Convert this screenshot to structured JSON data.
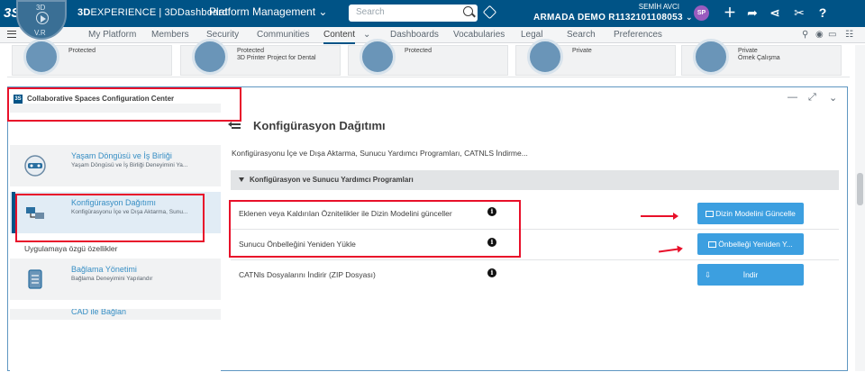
{
  "topbar": {
    "brand_logo": "3S",
    "compass_label": "V.R",
    "compass_quadrant_top": "3D",
    "app_name_bold": "3D",
    "app_name_rest": "EXPERIENCE",
    "app_separator": "|",
    "app_subtitle": "3DDashboard",
    "platform_label": "Platform Management",
    "search_placeholder": "Search",
    "user_name": "SEMİH AVCI",
    "tenant": "ARMADA DEMO R1132101108053",
    "avatar_initials": "SP",
    "icons": [
      "avatar",
      "add-icon",
      "share-icon",
      "network-icon",
      "tools-icon",
      "help-icon"
    ],
    "avatar_color": "#9a5cbf",
    "bar_color": "#005386"
  },
  "navbar": {
    "tabs": [
      {
        "label": "My Platform",
        "active": false
      },
      {
        "label": "Members",
        "active": false
      },
      {
        "label": "Security",
        "active": false
      },
      {
        "label": "Communities",
        "active": false
      },
      {
        "label": "Content",
        "active": true
      },
      {
        "label": "Dashboards",
        "active": false
      },
      {
        "label": "Vocabularies",
        "active": false
      },
      {
        "label": "Legal",
        "active": false
      },
      {
        "label": "Search",
        "active": false
      },
      {
        "label": "Preferences",
        "active": false
      }
    ]
  },
  "spaces_strip": [
    {
      "line1": "Protected",
      "line2": ""
    },
    {
      "line1": "Protected",
      "line2": "3D Printer Project for Dental"
    },
    {
      "line1": "Protected",
      "line2": ""
    },
    {
      "line1": "Private",
      "line2": ""
    },
    {
      "line1": "Private",
      "line2": "Örnek Çalışma"
    }
  ],
  "widget": {
    "title": "Collaborative Spaces Configuration Center",
    "controls": [
      "minimize-icon",
      "maximize-icon",
      "chevron-down-icon"
    ],
    "left_items": [
      {
        "title": "Yaşam Döngüsü ve İş Birliği",
        "subtitle": "Yaşam Döngüsü ve İş Birliği Deneyimini Ya...",
        "selected": false
      },
      {
        "title": "Konfigürasyon Dağıtımı",
        "subtitle": "Konfigürasyonu İçe ve Dışa Aktarma, Sunu...",
        "selected": true
      },
      {
        "title": "Bağlama Yönetimi",
        "subtitle": "Bağlama Deneyimini Yapılandır",
        "selected": false
      },
      {
        "title": "CAD ile Bağlan",
        "subtitle": "",
        "selected": false
      }
    ],
    "left_section_label": "Uygulamaya özgü özellikler",
    "right": {
      "title": "Konfigürasyon Dağıtımı",
      "description": "Konfigürasyonu İçe ve Dışa Aktarma, Sunucu Yardımcı Programları, CATNLS İndirme...",
      "section_label": "Konfigürasyon ve Sunucu Yardımcı Programları",
      "rows": [
        {
          "label": "Eklenen veya Kaldırılan Öznitelikler ile Dizin Modelini günceller",
          "button": "Dizin Modelini Güncelle"
        },
        {
          "label": "Sunucu Önbelleğini Yeniden Yükle",
          "button": "Önbelleği Yeniden Y..."
        },
        {
          "label": "CATNls Dosyalarını İndirir (ZIP Dosyası)",
          "button": "İndir"
        }
      ],
      "info_glyph": "i",
      "button_color": "#3c9fe0"
    }
  },
  "annotations": {
    "highlight_color": "#e8102a"
  }
}
